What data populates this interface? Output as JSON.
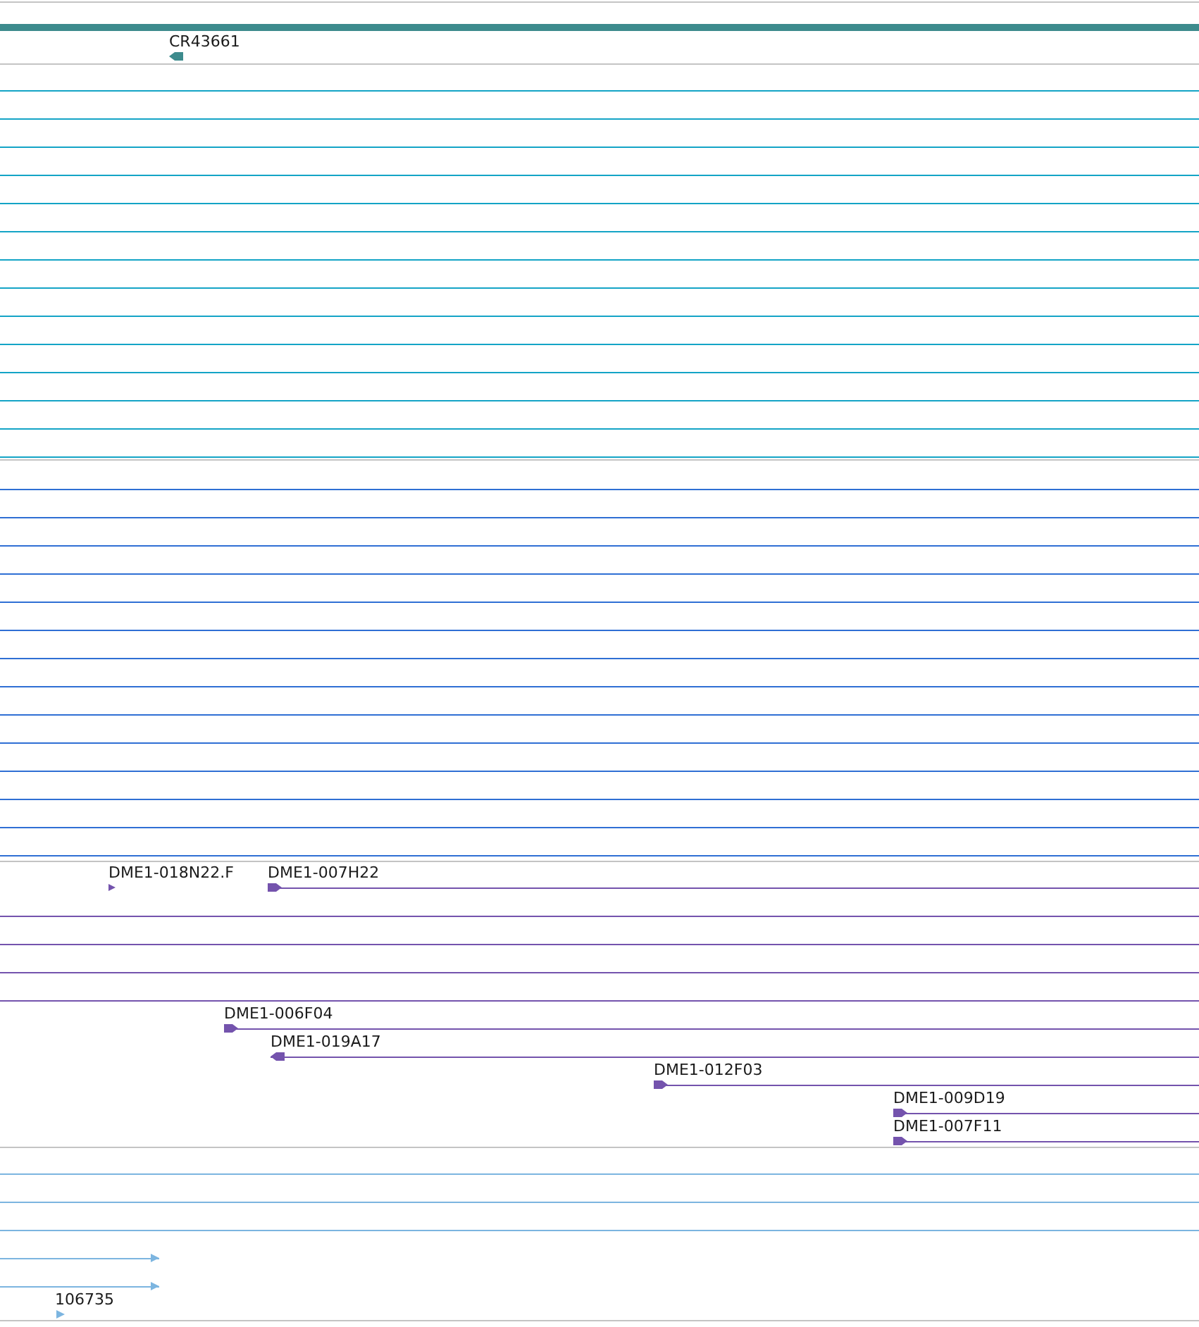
{
  "tracks": [
    {
      "bar": {
        "color": "#3d8b8d"
      },
      "color": "#3d8b8d",
      "rows": [
        {
          "features": [
            {
              "label": "CR43661",
              "head": true,
              "reverse": true
            }
          ]
        }
      ]
    },
    {
      "color": "#14a4c6",
      "rows": [
        {
          "features": [
            {
              "head": false
            }
          ]
        },
        {
          "features": [
            {
              "head": false
            }
          ]
        },
        {
          "features": [
            {
              "head": false
            }
          ]
        },
        {
          "features": [
            {
              "head": false
            }
          ]
        },
        {
          "features": [
            {
              "head": false
            }
          ]
        },
        {
          "features": [
            {
              "head": false
            }
          ]
        },
        {
          "features": [
            {
              "head": false
            }
          ]
        },
        {
          "features": [
            {
              "head": false
            }
          ]
        },
        {
          "features": [
            {
              "head": false
            }
          ]
        },
        {
          "features": [
            {
              "head": false
            }
          ]
        },
        {
          "features": [
            {
              "head": false
            }
          ]
        },
        {
          "features": [
            {
              "head": false
            }
          ]
        },
        {
          "features": [
            {
              "head": false
            }
          ]
        },
        {
          "features": [
            {
              "head": false
            }
          ]
        }
      ]
    },
    {
      "color": "#2f6fd4",
      "rows": [
        {
          "features": [
            {
              "head": false
            }
          ]
        },
        {
          "features": [
            {
              "head": false
            }
          ]
        },
        {
          "features": [
            {
              "head": false
            }
          ]
        },
        {
          "features": [
            {
              "head": false
            }
          ]
        },
        {
          "features": [
            {
              "head": false
            }
          ]
        },
        {
          "features": [
            {
              "head": false
            }
          ]
        },
        {
          "features": [
            {
              "head": false
            }
          ]
        },
        {
          "features": [
            {
              "head": false
            }
          ]
        },
        {
          "features": [
            {
              "head": false
            }
          ]
        },
        {
          "features": [
            {
              "head": false
            }
          ]
        },
        {
          "features": [
            {
              "head": false
            }
          ]
        },
        {
          "features": [
            {
              "head": false
            }
          ]
        },
        {
          "features": [
            {
              "head": false
            }
          ]
        },
        {
          "features": [
            {
              "head": false
            }
          ]
        }
      ]
    },
    {
      "color": "#7453ad",
      "rows": [
        {
          "features": [
            {
              "label": "DME1-018N22.F",
              "head": true,
              "reverse": false
            },
            {
              "label": "DME1-007H22",
              "head": true,
              "reverse": false
            }
          ]
        },
        {
          "features": [
            {
              "head": false
            }
          ]
        },
        {
          "features": [
            {
              "head": false
            }
          ]
        },
        {
          "features": [
            {
              "head": false
            }
          ]
        },
        {
          "features": [
            {
              "head": false
            }
          ]
        },
        {
          "features": [
            {
              "label": "DME1-006F04",
              "head": true,
              "reverse": false
            }
          ]
        },
        {
          "features": [
            {
              "label": "DME1-019A17",
              "head": true,
              "reverse": true
            }
          ]
        },
        {
          "features": [
            {
              "label": "DME1-012F03",
              "head": true,
              "reverse": false
            }
          ]
        },
        {
          "features": [
            {
              "label": "DME1-009D19",
              "head": true,
              "reverse": false
            }
          ]
        },
        {
          "features": [
            {
              "label": "DME1-007F11",
              "head": true,
              "reverse": false
            }
          ]
        }
      ]
    },
    {
      "color": "#7cb5e0",
      "rows": [
        {
          "features": [
            {
              "head": false
            }
          ]
        },
        {
          "features": [
            {
              "head": false
            }
          ]
        },
        {
          "features": [
            {
              "head": false
            }
          ]
        },
        {
          "features": [
            {
              "head": true,
              "reverse": false
            }
          ]
        },
        {
          "features": [
            {
              "head": true,
              "reverse": false
            }
          ]
        },
        {
          "features": [
            {
              "label": "106735",
              "head": true,
              "reverse": false
            }
          ]
        }
      ]
    }
  ]
}
